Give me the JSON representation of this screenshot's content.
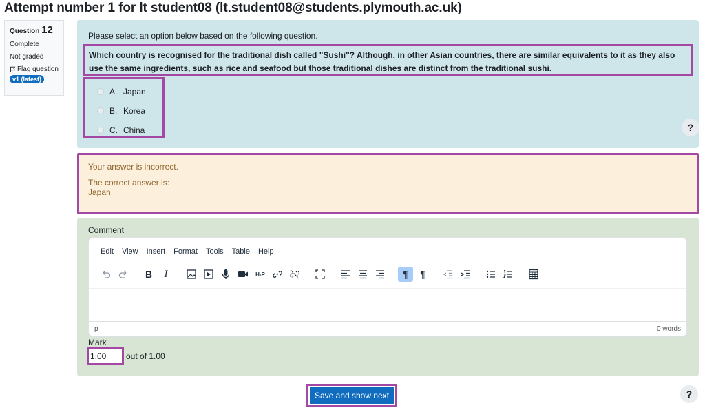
{
  "page": {
    "title": "Attempt number 1 for lt student08 (lt.student08@students.plymouth.ac.uk)"
  },
  "info": {
    "question_label": "Question",
    "question_number": "12",
    "status": "Complete",
    "grade": "Not graded",
    "flag_label": "Flag question",
    "version_badge": "v1 (latest)"
  },
  "question": {
    "prompt": "Please select an option below based on the following question.",
    "text": "Which country is recognised for the traditional dish called \"Sushi\"? Although, in other Asian countries, there are similar equivalents to it as they also use the same ingredients, such as rice and seafood but those traditional dishes are distinct from the traditional sushi.",
    "options": [
      {
        "letter": "A.",
        "label": "Japan"
      },
      {
        "letter": "B.",
        "label": "Korea"
      },
      {
        "letter": "C.",
        "label": "China"
      }
    ],
    "help_label": "?"
  },
  "feedback": {
    "result": "Your answer is incorrect.",
    "correct_label": "The correct answer is:",
    "correct_value": "Japan"
  },
  "comment": {
    "label": "Comment",
    "menu": [
      "Edit",
      "View",
      "Insert",
      "Format",
      "Tools",
      "Table",
      "Help"
    ],
    "toolbar_text": {
      "bold": "B",
      "italic": "I",
      "h5p": "H-P",
      "ltr": "¶",
      "rtl": "¶"
    },
    "status_path": "p",
    "word_count": "0 words",
    "mark_label": "Mark",
    "mark_value": "1.00",
    "mark_out_of": "out of 1.00"
  },
  "footer": {
    "save_button": "Save and show next",
    "help_label": "?"
  },
  "colors": {
    "question_bg": "#cee5ea",
    "feedback_bg": "#fcefdc",
    "comment_bg": "#d8e5d4",
    "highlight_border": "#a349a4",
    "primary": "#0f6cbf"
  }
}
